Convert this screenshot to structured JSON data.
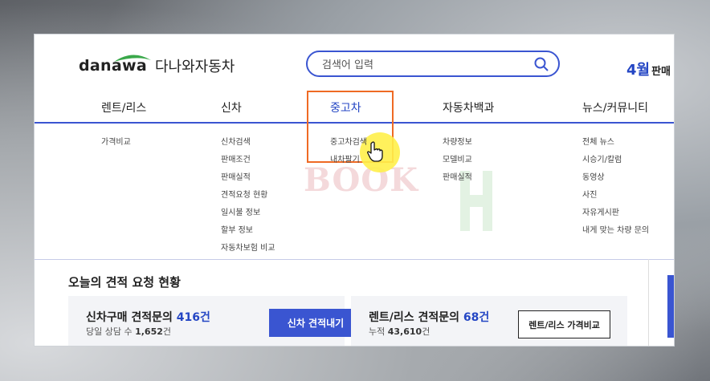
{
  "header": {
    "logo_text": "danawa",
    "site_title": "다나와자동차",
    "promo": "4월",
    "promo_rest": "판매"
  },
  "search": {
    "placeholder": "검색어 입력"
  },
  "nav": {
    "items": [
      "렌트/리스",
      "신차",
      "중고차",
      "자동차백과",
      "뉴스/커뮤니티"
    ],
    "active": "중고차"
  },
  "menus": {
    "rent": [
      "가격비교"
    ],
    "newcar": [
      "신차검색",
      "판매조건",
      "판매실적",
      "견적요청 현황",
      "일시불 정보",
      "할부 정보",
      "자동차보험 비교"
    ],
    "used": [
      "중고차검색",
      "내차팔기"
    ],
    "encyclopedia": [
      "차량정보",
      "모델비교",
      "판매실적"
    ],
    "news": [
      "전체 뉴스",
      "시승기/칼럼",
      "동영상",
      "사진",
      "자유게시판",
      "내게 맞는 차량 문의"
    ]
  },
  "watermark": "BOOK",
  "quotes": {
    "title": "오늘의 견적 요청 현황",
    "newcar": {
      "label": "신차구매 견적문의",
      "count": "416",
      "unit": "건",
      "sub_label": "당일 상담 수",
      "sub_count": "1,652",
      "sub_unit": "건",
      "button": "신차 견적내기"
    },
    "rent": {
      "label": "렌트/리스 견적문의",
      "count": "68",
      "unit": "건",
      "sub_label": "누적",
      "sub_count": "43,610",
      "sub_unit": "건",
      "button": "렌트/리스 가격비교"
    }
  },
  "colors": {
    "accent": "#3a55d1",
    "highlight_box": "#ef6a24",
    "logo_green": "#3aa84a"
  },
  "icons": {
    "search": "search-icon",
    "cursor": "hand-pointer-icon"
  }
}
